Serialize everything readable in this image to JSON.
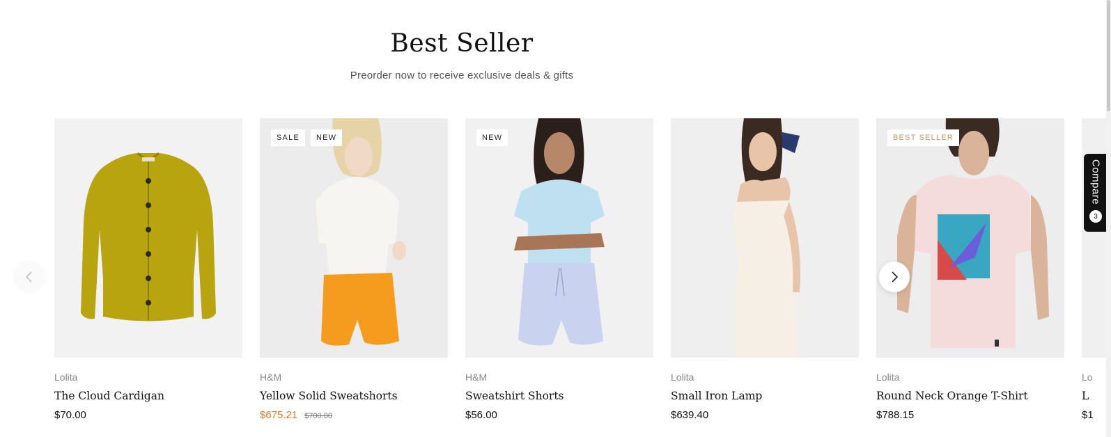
{
  "section": {
    "title": "Best Seller",
    "subtitle": "Preorder now to receive exclusive deals & gifts"
  },
  "products": [
    {
      "vendor": "Lolita",
      "title": "The Cloud Cardigan",
      "price": "$70.00",
      "compare_price": "",
      "badges": []
    },
    {
      "vendor": "H&M",
      "title": "Yellow Solid Sweatshorts",
      "price": "$675.21",
      "compare_price": "$700.00",
      "badges": [
        "SALE",
        "NEW"
      ]
    },
    {
      "vendor": "H&M",
      "title": "Sweatshirt Shorts",
      "price": "$56.00",
      "compare_price": "",
      "badges": [
        "NEW"
      ]
    },
    {
      "vendor": "Lolita",
      "title": "Small Iron Lamp",
      "price": "$639.40",
      "compare_price": "",
      "badges": []
    },
    {
      "vendor": "Lolita",
      "title": "Round Neck Orange T-Shirt",
      "price": "$788.15",
      "compare_price": "",
      "badges": [
        "BEST SELLER"
      ]
    },
    {
      "vendor": "Lo",
      "title": "L",
      "price": "$1",
      "compare_price": "",
      "badges": []
    }
  ],
  "compare_tab": {
    "label": "Compare",
    "count": "3"
  },
  "icons": {
    "prev": "chevron-left-icon",
    "next": "chevron-right-icon"
  },
  "colors": {
    "sale_price": "#e07b2c",
    "best_seller_badge": "#c49466",
    "compare_tab_bg": "#111111"
  }
}
